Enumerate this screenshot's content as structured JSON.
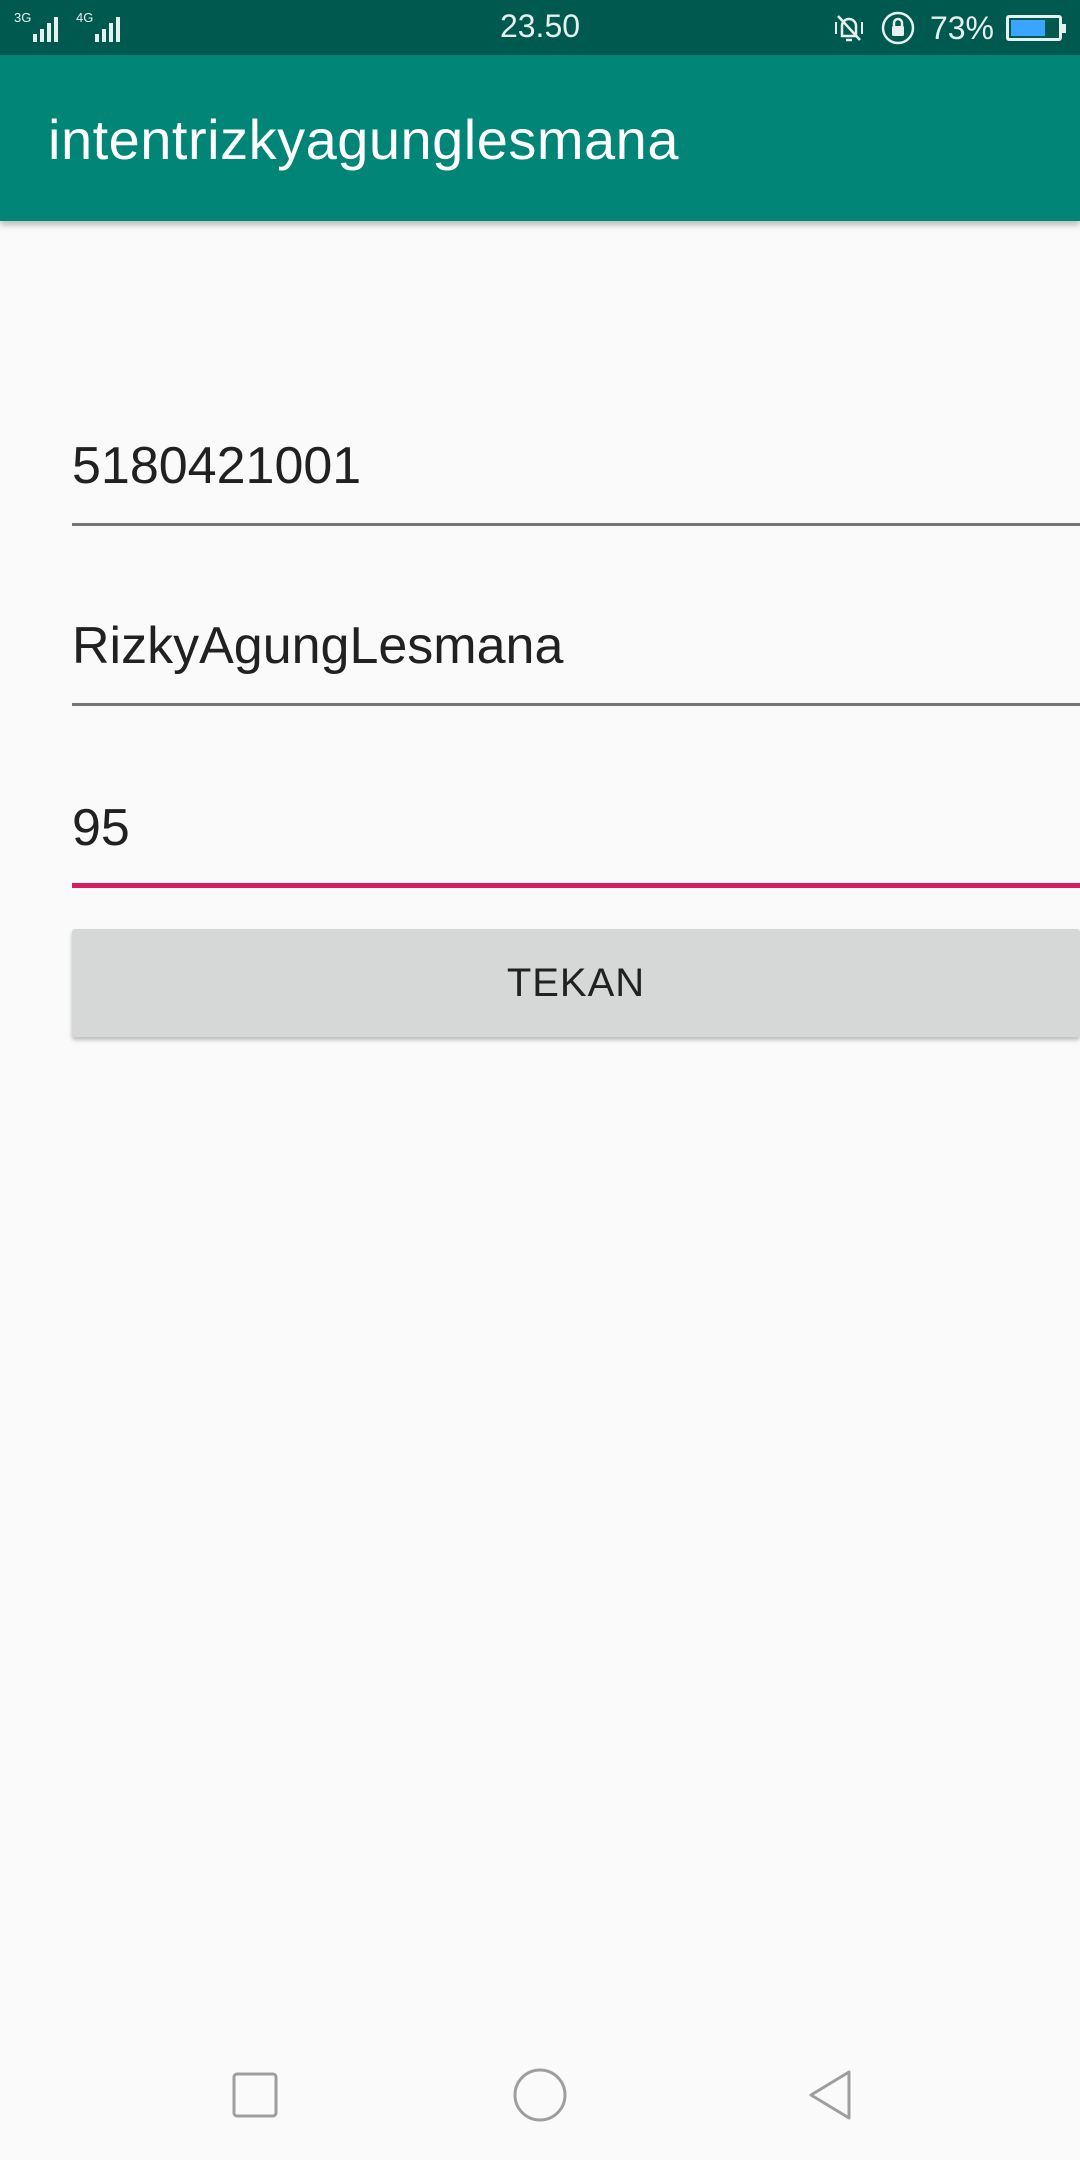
{
  "status_bar": {
    "network_1": "3G",
    "network_2": "4G",
    "time": "23.50",
    "battery_percent": "73%",
    "battery_level": 0.73,
    "icons": [
      "signal-icon",
      "vibrate-icon",
      "rotation-lock-icon",
      "battery-icon"
    ]
  },
  "app_bar": {
    "title": "intentrizkyagunglesmana",
    "color": "#008577"
  },
  "form": {
    "field1": {
      "value": "5180421001"
    },
    "field2": {
      "value": "RizkyAgungLesmana"
    },
    "field3": {
      "value": "95"
    },
    "button_label": "TEKAN",
    "accent_color": "#d81b60"
  },
  "nav_bar": {
    "icons": [
      "recent-apps-icon",
      "home-icon",
      "back-icon"
    ]
  }
}
